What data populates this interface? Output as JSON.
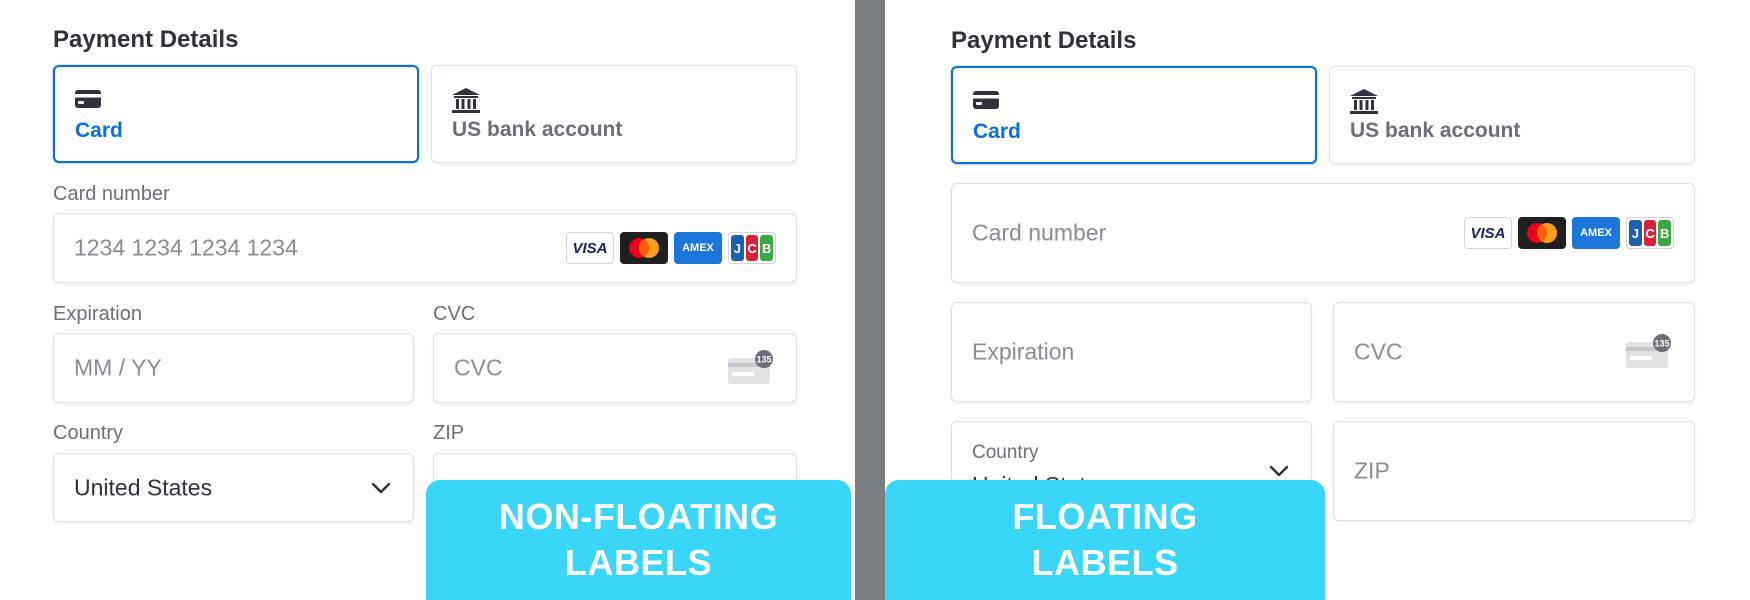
{
  "left": {
    "title": "Payment Details",
    "tabs": [
      {
        "label": "Card",
        "icon": "card-icon",
        "selected": true
      },
      {
        "label": "US bank account",
        "icon": "bank-icon",
        "selected": false
      }
    ],
    "card_number": {
      "label": "Card number",
      "placeholder": "1234 1234 1234 1234"
    },
    "expiration": {
      "label": "Expiration",
      "placeholder": "MM / YY"
    },
    "cvc": {
      "label": "CVC",
      "placeholder": "CVC"
    },
    "country": {
      "label": "Country",
      "value": "United States"
    },
    "zip": {
      "label": "ZIP"
    },
    "banner": {
      "line1": "NON-FLOATING",
      "line2": "LABELS"
    }
  },
  "right": {
    "title": "Payment Details",
    "tabs": [
      {
        "label": "Card",
        "icon": "card-icon",
        "selected": true
      },
      {
        "label": "US bank account",
        "icon": "bank-icon",
        "selected": false
      }
    ],
    "card_number": {
      "placeholder": "Card number"
    },
    "expiration": {
      "placeholder": "Expiration"
    },
    "cvc": {
      "placeholder": "CVC"
    },
    "country": {
      "label": "Country",
      "value": "United States"
    },
    "zip": {
      "placeholder": "ZIP"
    },
    "banner": {
      "line1": "FLOATING",
      "line2": "LABELS"
    }
  },
  "card_brands": [
    "VISA",
    "Mastercard",
    "AMEX",
    "JCB"
  ],
  "cvc_badge": "135",
  "colors": {
    "accent": "#0570de",
    "banner": "#3ad6f7",
    "divider": "#7a7e81"
  }
}
